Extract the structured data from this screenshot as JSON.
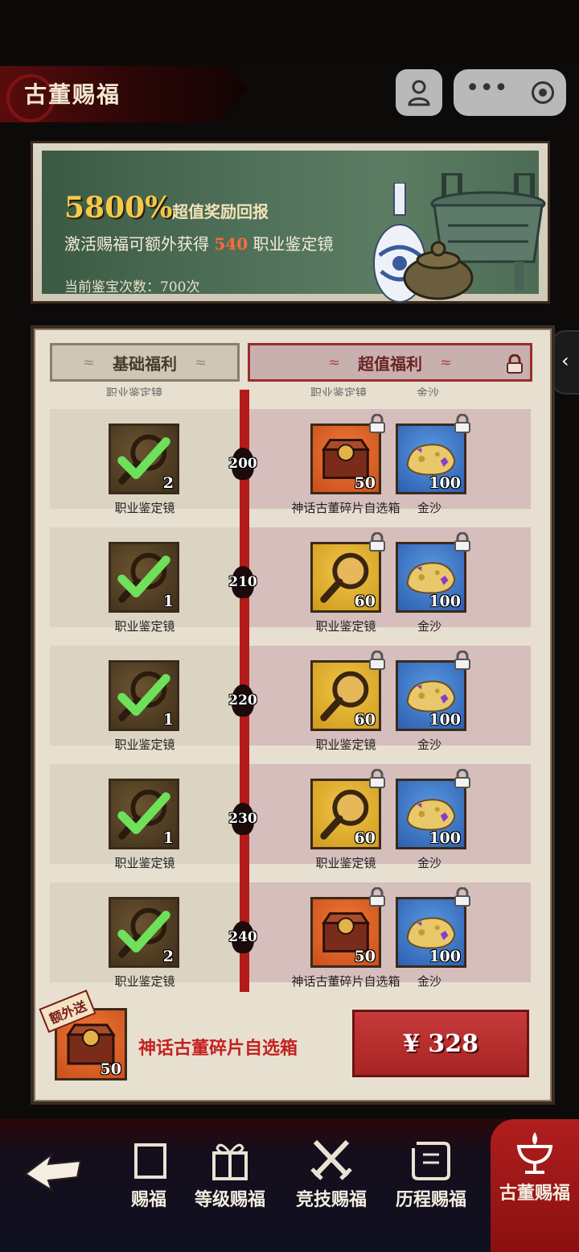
{
  "header": {
    "title": "古董赐福"
  },
  "banner": {
    "percent": "5800%",
    "percent_caption": "超值奖励回报",
    "line_prefix": "激活赐福可额外获得",
    "line_amount": "540",
    "line_suffix": "职业鉴定镜",
    "count_text": "当前鉴宝次数：700次"
  },
  "tabs": {
    "basic": "基础福利",
    "super": "超值福利"
  },
  "cutoff_labels": [
    "职业鉴定镜",
    "职业鉴定镜",
    "金沙"
  ],
  "rows": [
    {
      "level": "200",
      "basic": {
        "name": "职业鉴定镜",
        "qty": "2",
        "claimed": true
      },
      "super": [
        {
          "name": "神话古董碎片自选箱",
          "qty": "50",
          "icon": "chest-icon"
        },
        {
          "name": "金沙",
          "qty": "100",
          "icon": "gold-sand-icon"
        }
      ]
    },
    {
      "level": "210",
      "basic": {
        "name": "职业鉴定镜",
        "qty": "1",
        "claimed": true
      },
      "super": [
        {
          "name": "职业鉴定镜",
          "qty": "60",
          "icon": "magnifier-icon"
        },
        {
          "name": "金沙",
          "qty": "100",
          "icon": "gold-sand-icon"
        }
      ]
    },
    {
      "level": "220",
      "basic": {
        "name": "职业鉴定镜",
        "qty": "1",
        "claimed": true
      },
      "super": [
        {
          "name": "职业鉴定镜",
          "qty": "60",
          "icon": "magnifier-icon"
        },
        {
          "name": "金沙",
          "qty": "100",
          "icon": "gold-sand-icon"
        }
      ]
    },
    {
      "level": "230",
      "basic": {
        "name": "职业鉴定镜",
        "qty": "1",
        "claimed": true
      },
      "super": [
        {
          "name": "职业鉴定镜",
          "qty": "60",
          "icon": "magnifier-icon"
        },
        {
          "name": "金沙",
          "qty": "100",
          "icon": "gold-sand-icon"
        }
      ]
    },
    {
      "level": "240",
      "basic": {
        "name": "职业鉴定镜",
        "qty": "2",
        "claimed": true
      },
      "super": [
        {
          "name": "神话古董碎片自选箱",
          "qty": "50",
          "icon": "chest-icon"
        },
        {
          "name": "金沙",
          "qty": "100",
          "icon": "gold-sand-icon"
        }
      ]
    }
  ],
  "bonus": {
    "tag": "额外送",
    "name": "神话古董碎片自选箱",
    "qty": "50"
  },
  "purchase": {
    "price": "¥ 328"
  },
  "nav": {
    "items": [
      {
        "label": "赐福",
        "icon": "blessing-icon"
      },
      {
        "label": "等级赐福",
        "icon": "gift-icon"
      },
      {
        "label": "竞技赐福",
        "icon": "crossed-swords-icon"
      },
      {
        "label": "历程赐福",
        "icon": "scroll-icon"
      },
      {
        "label": "古董赐福",
        "icon": "chalice-icon",
        "active": true
      }
    ]
  },
  "colors": {
    "accent_red": "#b31a1a",
    "highlight_gold": "#f4c84a",
    "highlight_orange": "#ff6a3a"
  }
}
